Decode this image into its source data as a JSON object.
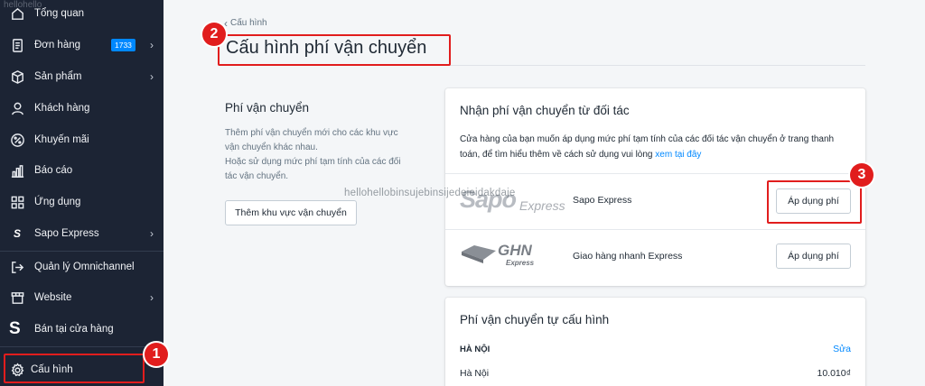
{
  "sidebar": {
    "items": [
      {
        "label": "Tổng quan"
      },
      {
        "label": "Đơn hàng",
        "badge": "1733"
      },
      {
        "label": "Sản phẩm"
      },
      {
        "label": "Khách hàng"
      },
      {
        "label": "Khuyến mãi"
      },
      {
        "label": "Báo cáo"
      },
      {
        "label": "Ứng dụng"
      },
      {
        "label": "Sapo Express"
      },
      {
        "label": "Quản lý Omnichannel"
      },
      {
        "label": "Website"
      },
      {
        "label": "Bán tại cửa hàng"
      },
      {
        "label": "Cấu hình"
      }
    ]
  },
  "breadcrumb": {
    "back_label": "Cấu hình"
  },
  "page": {
    "title": "Cấu hình phí vận chuyển"
  },
  "shipping_zone_section": {
    "title": "Phí vận chuyển",
    "description_1": "Thêm phí vận chuyển mới cho các khu vực vận chuyển khác nhau.",
    "description_2": "Hoặc sử dụng mức phí tạm tính của các đối tác vận chuyển.",
    "add_button": "Thêm khu vực vận chuyển"
  },
  "partner_card": {
    "title": "Nhận phí vận chuyển từ đối tác",
    "description": "Cửa hàng của bạn muốn áp dụng mức phí tạm tính của các đối tác vận chuyển ở trang thanh toán, để tìm hiểu thêm về cách sử dụng vui lòng",
    "link": "xem tại đây",
    "partners": [
      {
        "logo_text": "Sapo",
        "logo_sub": "Express",
        "name": "Sapo Express",
        "button": "Áp dụng phí"
      },
      {
        "logo_text": "GHN",
        "logo_sub": "Express",
        "name": "Giao hàng nhanh Express",
        "button": "Áp dụng phí"
      }
    ]
  },
  "custom_card": {
    "title": "Phí vận chuyển tự cấu hình",
    "region": "HÀ NỘI",
    "edit_label": "Sửa",
    "rows": [
      {
        "name": "Hà Nội",
        "price": "10.010₫"
      }
    ]
  },
  "annotations": {
    "num1": "1",
    "num2": "2",
    "num3": "3"
  },
  "overlay": {
    "watermark": "hellohellobinsujebinsijedeieidakdaje",
    "top_text": "hellohello"
  },
  "colors": {
    "sidebar_bg": "#1c2434",
    "accent": "#0088ff",
    "annotation": "#e11d1d"
  }
}
